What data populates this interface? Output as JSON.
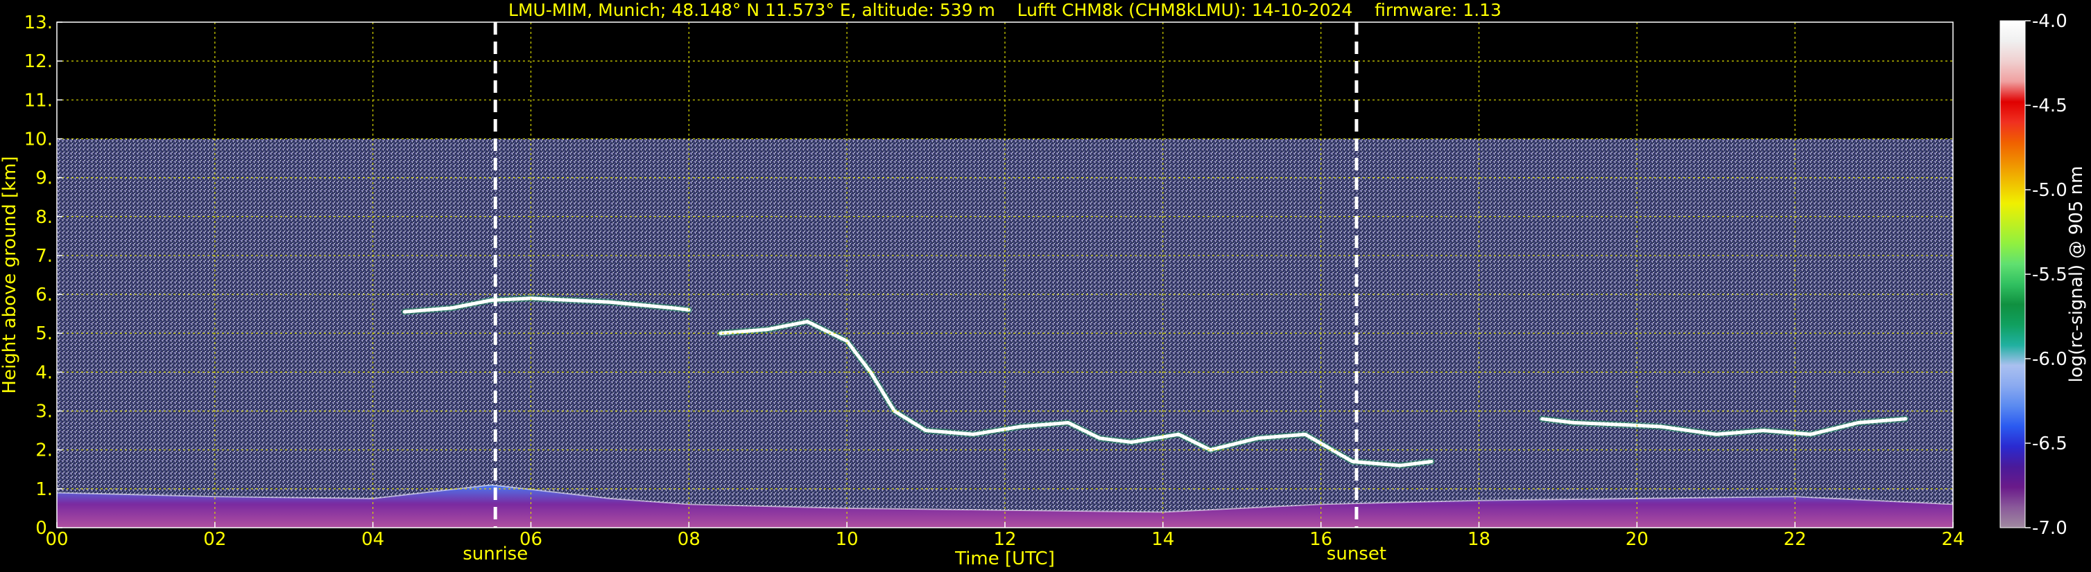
{
  "chart_data": {
    "type": "heatmap",
    "title": "LMU-MIM, Munich; 48.148° N 11.573° E, altitude: 539 m    Lufft CHM8k (CHM8kLMU): 14-10-2024    firmware: 1.13",
    "xlabel": "Time [UTC]",
    "ylabel": "Height above ground [km]",
    "xlim": [
      0,
      24
    ],
    "ylim": [
      0,
      13
    ],
    "x_ticks": [
      "00",
      "02",
      "04",
      "06",
      "08",
      "10",
      "12",
      "14",
      "16",
      "18",
      "20",
      "22",
      "24"
    ],
    "x_tick_values": [
      0,
      2,
      4,
      6,
      8,
      10,
      12,
      14,
      16,
      18,
      20,
      22,
      24
    ],
    "y_ticks": [
      "0.",
      "1.",
      "2.",
      "3.",
      "4.",
      "5.",
      "6.",
      "7.",
      "8.",
      "9.",
      "10.",
      "11.",
      "12.",
      "13."
    ],
    "y_tick_values": [
      0,
      1,
      2,
      3,
      4,
      5,
      6,
      7,
      8,
      9,
      10,
      11,
      12,
      13
    ],
    "grid": true,
    "data_top_km": 10,
    "events": [
      {
        "label": "sunrise",
        "time": 5.55
      },
      {
        "label": "sunset",
        "time": 16.45
      }
    ],
    "colorbar": {
      "label": "log(rc-signal) @ 905 nm",
      "ticks": [
        "-4.0",
        "-4.5",
        "-5.0",
        "-5.5",
        "-6.0",
        "-6.5",
        "-7.0"
      ],
      "tick_values": [
        -4.0,
        -4.5,
        -5.0,
        -5.5,
        -6.0,
        -6.5,
        -7.0
      ],
      "range": [
        -7.0,
        -4.0
      ],
      "colors": [
        "#a08aa0",
        "#8a5a9a",
        "#6a1a8a",
        "#4a1a9a",
        "#2a2ad0",
        "#2a5af0",
        "#5a8af0",
        "#8aaaf0",
        "#aac0f0",
        "#20b0a0",
        "#10a060",
        "#109040",
        "#30c060",
        "#60e070",
        "#90f040",
        "#c0f020",
        "#f0f000",
        "#f0c000",
        "#f09000",
        "#f06000",
        "#f03020",
        "#e00000",
        "#f0a0a0",
        "#f0d0d0",
        "#f0f0f0",
        "#ffffff"
      ]
    },
    "layers": [
      {
        "name": "boundary layer",
        "points": [
          [
            0,
            0.9
          ],
          [
            2,
            0.8
          ],
          [
            4,
            0.75
          ],
          [
            5.5,
            1.1
          ],
          [
            7,
            0.75
          ],
          [
            8,
            0.6
          ],
          [
            10,
            0.5
          ],
          [
            12,
            0.45
          ],
          [
            14,
            0.4
          ],
          [
            16,
            0.6
          ],
          [
            18,
            0.7
          ],
          [
            20,
            0.75
          ],
          [
            22,
            0.8
          ],
          [
            24,
            0.6
          ]
        ]
      },
      {
        "name": "cloud 1",
        "points": [
          [
            4.4,
            5.55
          ],
          [
            5.0,
            5.65
          ],
          [
            5.5,
            5.85
          ],
          [
            6.0,
            5.9
          ],
          [
            7.0,
            5.8
          ],
          [
            7.8,
            5.65
          ],
          [
            8.0,
            5.6
          ]
        ]
      },
      {
        "name": "cloud 2",
        "points": [
          [
            8.4,
            5.0
          ],
          [
            9.0,
            5.1
          ],
          [
            9.5,
            5.3
          ],
          [
            10.0,
            4.8
          ],
          [
            10.3,
            4.0
          ],
          [
            10.6,
            3.0
          ],
          [
            11.0,
            2.5
          ],
          [
            11.6,
            2.4
          ],
          [
            12.2,
            2.6
          ],
          [
            12.8,
            2.7
          ],
          [
            13.2,
            2.3
          ],
          [
            13.6,
            2.2
          ],
          [
            14.2,
            2.4
          ],
          [
            14.6,
            2.0
          ],
          [
            15.2,
            2.3
          ],
          [
            15.8,
            2.4
          ],
          [
            16.4,
            1.7
          ],
          [
            17.0,
            1.6
          ],
          [
            17.4,
            1.7
          ]
        ]
      },
      {
        "name": "cloud 3",
        "points": [
          [
            18.8,
            2.8
          ],
          [
            19.2,
            2.7
          ],
          [
            19.8,
            2.65
          ],
          [
            20.3,
            2.6
          ],
          [
            21.0,
            2.4
          ],
          [
            21.6,
            2.5
          ],
          [
            22.2,
            2.4
          ],
          [
            22.8,
            2.7
          ],
          [
            23.4,
            2.8
          ]
        ]
      }
    ]
  }
}
